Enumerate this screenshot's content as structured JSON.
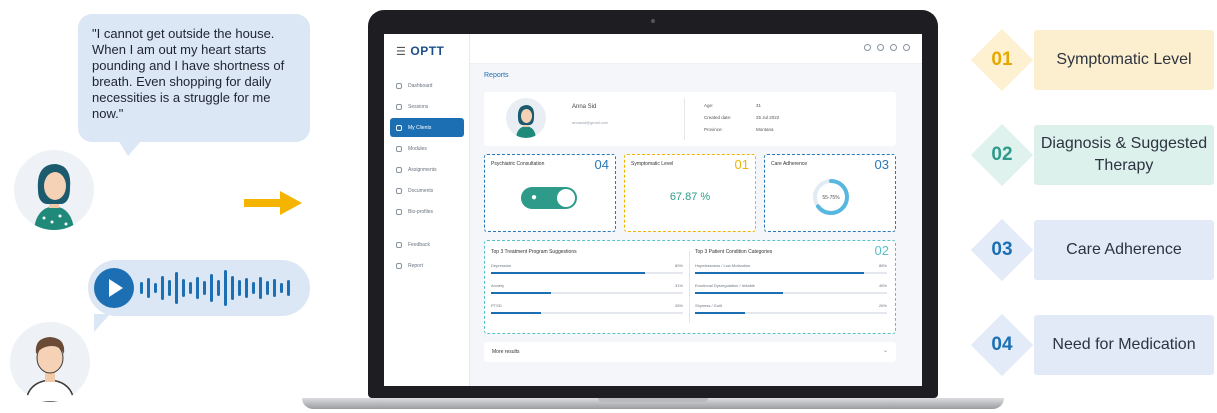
{
  "conversation": {
    "patient_quote": "\"I cannot get outside the house. When I am out my heart starts pounding and I have shortness of breath. Even shopping for daily necessities is a struggle for me now.\""
  },
  "app": {
    "logo": "OPTT",
    "nav": [
      {
        "label": "Dashboard",
        "active": false
      },
      {
        "label": "Sessions",
        "active": false
      },
      {
        "label": "My Clients",
        "active": true
      },
      {
        "label": "Modules",
        "active": false
      },
      {
        "label": "Assignments",
        "active": false
      },
      {
        "label": "Documents",
        "active": false
      },
      {
        "label": "Bio-profiles",
        "active": false
      },
      {
        "label": "Feedback",
        "active": false
      },
      {
        "label": "Report",
        "active": false
      }
    ],
    "page_title": "Reports",
    "patient": {
      "name": "Anna Sid",
      "email": "annasid@gmail.com",
      "age_label": "Age:",
      "age": "31",
      "created_label": "Created date:",
      "created": "25 Jul 2022",
      "province_label": "Province:",
      "province": "Montana"
    },
    "cards": {
      "psychiatric": {
        "title": "Psychiatric Consultation",
        "num": "04"
      },
      "symptomatic": {
        "title": "Symptomatic Level",
        "num": "01",
        "value": "67.87 %"
      },
      "care": {
        "title": "Care Adherence",
        "num": "03",
        "ring_label": "55-75%",
        "ring_fraction": 0.65
      },
      "wide": {
        "num": "02",
        "left_title": "Top 3 Treatment Program Suggestions",
        "left_rows": [
          {
            "label": "Depression",
            "pct": "80%",
            "value": 0.8
          },
          {
            "label": "Anxiety",
            "pct": "31%",
            "value": 0.31
          },
          {
            "label": "PTSD",
            "pct": "26%",
            "value": 0.26
          }
        ],
        "right_title": "Top 3 Patient Condition Categories",
        "right_rows": [
          {
            "label": "Hopelessness / Low Motivation",
            "pct": "88%",
            "value": 0.88
          },
          {
            "label": "Emotional Dysregulation / Irritable",
            "pct": "46%",
            "value": 0.46
          },
          {
            "label": "Shyness / Guilt",
            "pct": "26%",
            "value": 0.26
          }
        ]
      }
    },
    "more_results": "More results"
  },
  "legend": [
    {
      "num": "01",
      "label": "Symptomatic Level"
    },
    {
      "num": "02",
      "label": "Diagnosis & Suggested Therapy"
    },
    {
      "num": "03",
      "label": "Care Adherence"
    },
    {
      "num": "04",
      "label": "Need for Medication"
    }
  ],
  "colors": {
    "primary_blue": "#1c6fb3",
    "teal": "#2d9a8a",
    "gold": "#f0b400",
    "bubble": "#dbe7f5"
  }
}
